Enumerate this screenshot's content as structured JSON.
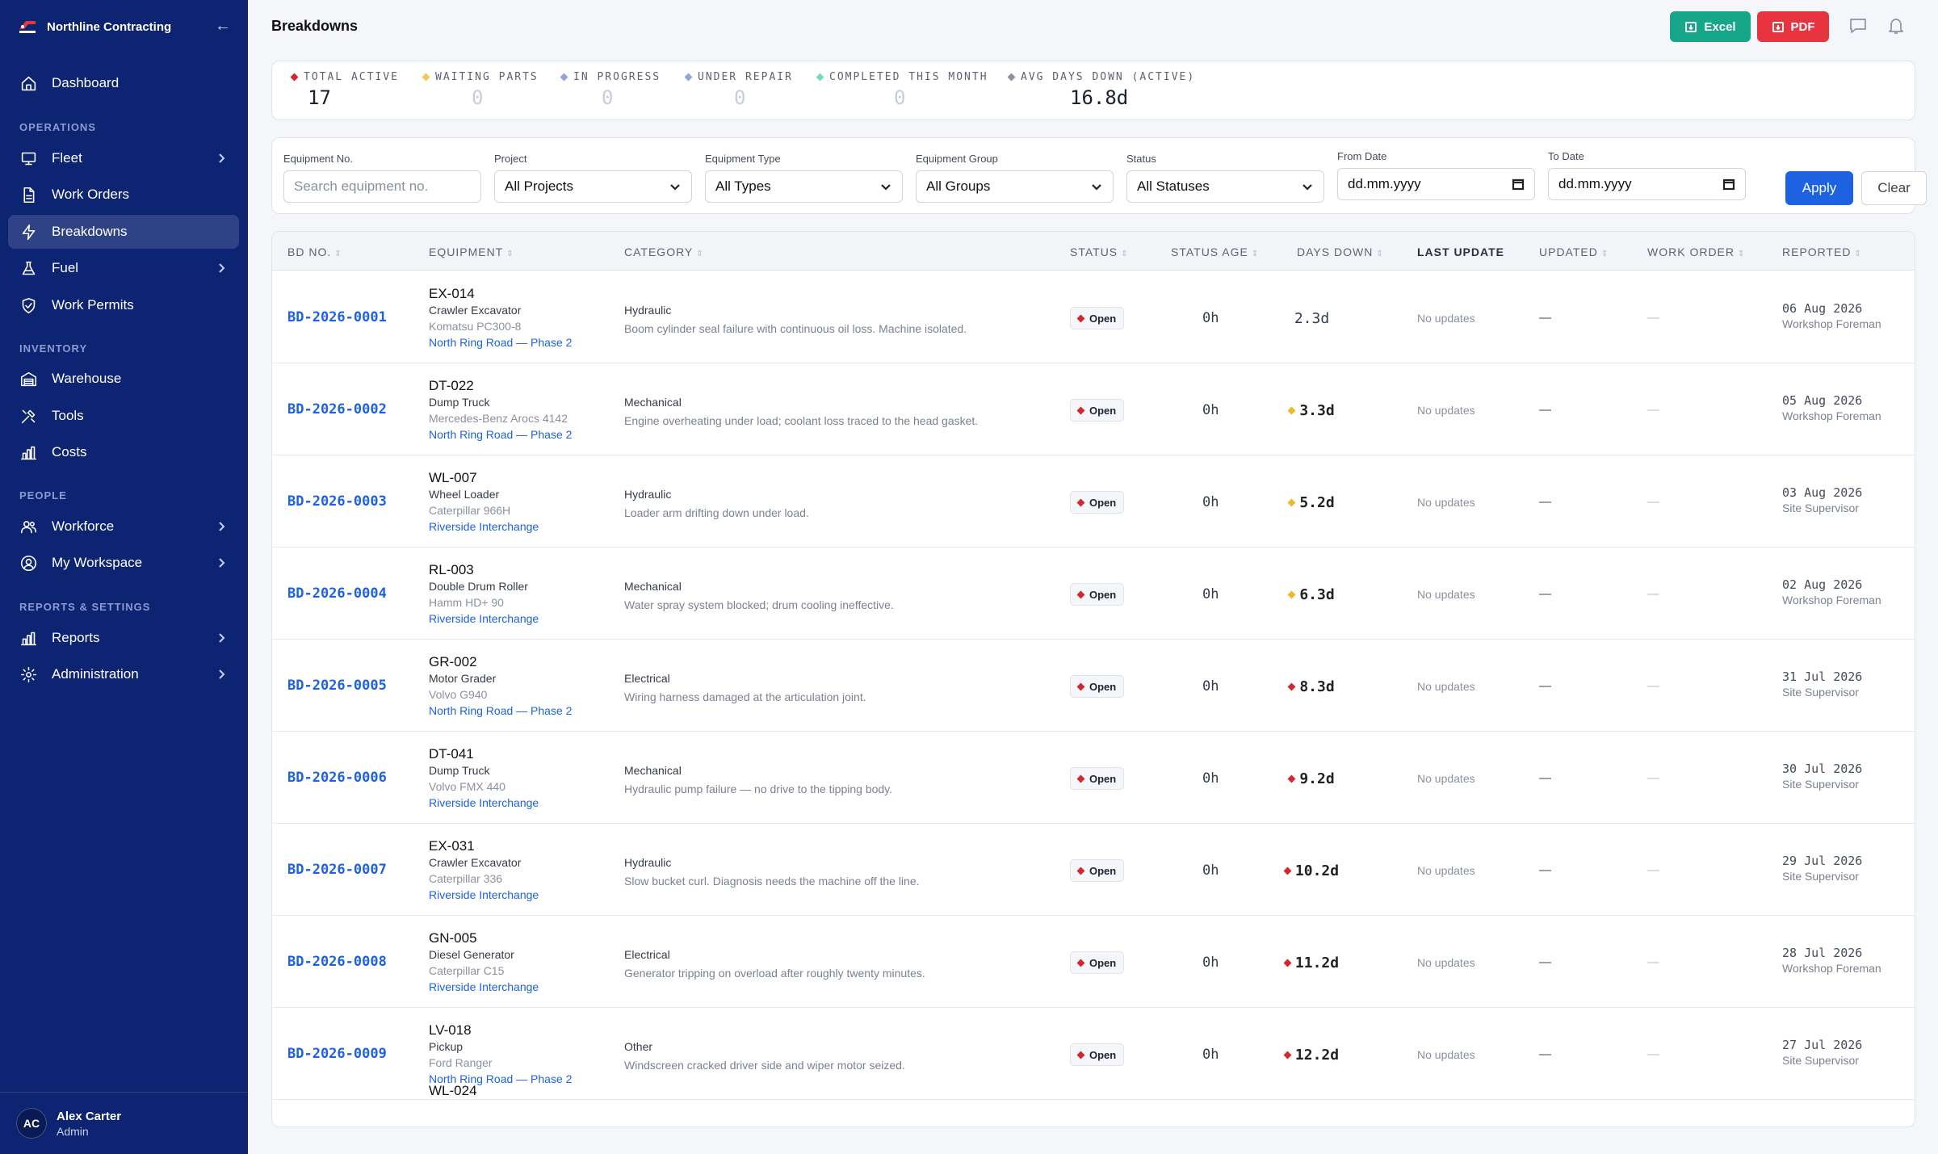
{
  "app": {
    "company": "Northline Contracting"
  },
  "sidebar": {
    "sections": {
      "operations": "OPERATIONS",
      "inventory": "INVENTORY",
      "people": "PEOPLE",
      "reports": "REPORTS & SETTINGS"
    },
    "items": {
      "dashboard": "Dashboard",
      "fleet": "Fleet",
      "work_orders": "Work Orders",
      "breakdowns": "Breakdowns",
      "fuel": "Fuel",
      "work_permits": "Work Permits",
      "warehouse": "Warehouse",
      "tools": "Tools",
      "costs": "Costs",
      "workforce": "Workforce",
      "my_workspace": "My Workspace",
      "reports": "Reports",
      "administration": "Administration"
    },
    "user": {
      "initials": "AC",
      "name": "Alex Carter",
      "role": "Admin"
    }
  },
  "header": {
    "title": "Breakdowns",
    "excel_label": "Excel",
    "pdf_label": "PDF"
  },
  "stats": [
    {
      "label": "TOTAL ACTIVE",
      "value": "17",
      "color": "#d7262f"
    },
    {
      "label": "WAITING PARTS",
      "value": "0",
      "color": "#f2c94c"
    },
    {
      "label": "IN PROGRESS",
      "value": "0",
      "color": "#8ea5e0"
    },
    {
      "label": "UNDER REPAIR",
      "value": "0",
      "color": "#8ea5e0"
    },
    {
      "label": "COMPLETED THIS MONTH",
      "value": "0",
      "color": "#7fd8c0"
    },
    {
      "label": "AVG DAYS DOWN (ACTIVE)",
      "value": "16.8d",
      "color": "#8c93a3"
    }
  ],
  "filters": {
    "equipment_no": {
      "label": "Equipment No.",
      "placeholder": "Search equipment no."
    },
    "project": {
      "label": "Project",
      "value": "All Projects"
    },
    "equipment_type": {
      "label": "Equipment Type",
      "value": "All Types"
    },
    "equipment_group": {
      "label": "Equipment Group",
      "value": "All Groups"
    },
    "status": {
      "label": "Status",
      "value": "All Statuses"
    },
    "from_date": {
      "label": "From Date",
      "value": "dd.mm.yyyy"
    },
    "to_date": {
      "label": "To Date",
      "value": "dd.mm.yyyy"
    },
    "apply_label": "Apply",
    "clear_label": "Clear"
  },
  "table": {
    "columns": {
      "bd_no": "BD NO.",
      "equipment": "EQUIPMENT",
      "category": "CATEGORY",
      "status": "STATUS",
      "status_age": "STATUS AGE",
      "days_down": "DAYS DOWN",
      "last_update": "LAST UPDATE",
      "updated": "UPDATED",
      "work_order": "WORK ORDER",
      "reported": "REPORTED"
    },
    "rows": [
      {
        "bd_no": "BD-2026-0001",
        "eq_code": "EX-014",
        "eq_type": "Crawler Excavator",
        "eq_model": "Komatsu PC300-8",
        "site": "North Ring Road — Phase 2",
        "category": "Hydraulic",
        "description": "Boom cylinder seal failure with continuous oil loss. Machine isolated.",
        "status": "Open",
        "status_age": "0h",
        "days_down": "2.3d",
        "severity": "none",
        "last_update": "No updates",
        "updated": "—",
        "work_order": "—",
        "reported_date": "06 Aug 2026",
        "reported_by": "Workshop Foreman"
      },
      {
        "bd_no": "BD-2026-0002",
        "eq_code": "DT-022",
        "eq_type": "Dump Truck",
        "eq_model": "Mercedes-Benz Arocs 4142",
        "site": "North Ring Road — Phase 2",
        "category": "Mechanical",
        "description": "Engine overheating under load; coolant loss traced to the head gasket.",
        "status": "Open",
        "status_age": "0h",
        "days_down": "3.3d",
        "severity": "warning",
        "last_update": "No updates",
        "updated": "—",
        "work_order": "—",
        "reported_date": "05 Aug 2026",
        "reported_by": "Workshop Foreman"
      },
      {
        "bd_no": "BD-2026-0003",
        "eq_code": "WL-007",
        "eq_type": "Wheel Loader",
        "eq_model": "Caterpillar 966H",
        "site": "Riverside Interchange",
        "category": "Hydraulic",
        "description": "Loader arm drifting down under load.",
        "status": "Open",
        "status_age": "0h",
        "days_down": "5.2d",
        "severity": "warning",
        "last_update": "No updates",
        "updated": "—",
        "work_order": "—",
        "reported_date": "03 Aug 2026",
        "reported_by": "Site Supervisor"
      },
      {
        "bd_no": "BD-2026-0004",
        "eq_code": "RL-003",
        "eq_type": "Double Drum Roller",
        "eq_model": "Hamm HD+ 90",
        "site": "Riverside Interchange",
        "category": "Mechanical",
        "description": "Water spray system blocked; drum cooling ineffective.",
        "status": "Open",
        "status_age": "0h",
        "days_down": "6.3d",
        "severity": "warning",
        "last_update": "No updates",
        "updated": "—",
        "work_order": "—",
        "reported_date": "02 Aug 2026",
        "reported_by": "Workshop Foreman"
      },
      {
        "bd_no": "BD-2026-0005",
        "eq_code": "GR-002",
        "eq_type": "Motor Grader",
        "eq_model": "Volvo G940",
        "site": "North Ring Road — Phase 2",
        "category": "Electrical",
        "description": "Wiring harness damaged at the articulation joint.",
        "status": "Open",
        "status_age": "0h",
        "days_down": "8.3d",
        "severity": "critical",
        "last_update": "No updates",
        "updated": "—",
        "work_order": "—",
        "reported_date": "31 Jul 2026",
        "reported_by": "Site Supervisor"
      },
      {
        "bd_no": "BD-2026-0006",
        "eq_code": "DT-041",
        "eq_type": "Dump Truck",
        "eq_model": "Volvo FMX 440",
        "site": "Riverside Interchange",
        "category": "Mechanical",
        "description": "Hydraulic pump failure — no drive to the tipping body.",
        "status": "Open",
        "status_age": "0h",
        "days_down": "9.2d",
        "severity": "critical",
        "last_update": "No updates",
        "updated": "—",
        "work_order": "—",
        "reported_date": "30 Jul 2026",
        "reported_by": "Site Supervisor"
      },
      {
        "bd_no": "BD-2026-0007",
        "eq_code": "EX-031",
        "eq_type": "Crawler Excavator",
        "eq_model": "Caterpillar 336",
        "site": "Riverside Interchange",
        "category": "Hydraulic",
        "description": "Slow bucket curl. Diagnosis needs the machine off the line.",
        "status": "Open",
        "status_age": "0h",
        "days_down": "10.2d",
        "severity": "critical",
        "last_update": "No updates",
        "updated": "—",
        "work_order": "—",
        "reported_date": "29 Jul 2026",
        "reported_by": "Site Supervisor"
      },
      {
        "bd_no": "BD-2026-0008",
        "eq_code": "GN-005",
        "eq_type": "Diesel Generator",
        "eq_model": "Caterpillar C15",
        "site": "Riverside Interchange",
        "category": "Electrical",
        "description": "Generator tripping on overload after roughly twenty minutes.",
        "status": "Open",
        "status_age": "0h",
        "days_down": "11.2d",
        "severity": "critical",
        "last_update": "No updates",
        "updated": "—",
        "work_order": "—",
        "reported_date": "28 Jul 2026",
        "reported_by": "Workshop Foreman"
      },
      {
        "bd_no": "BD-2026-0009",
        "eq_code": "LV-018",
        "eq_type": "Pickup",
        "eq_model": "Ford Ranger",
        "site": "North Ring Road — Phase 2",
        "category": "Other",
        "description": "Windscreen cracked driver side and wiper motor seized.",
        "status": "Open",
        "status_age": "0h",
        "days_down": "12.2d",
        "severity": "critical",
        "last_update": "No updates",
        "updated": "—",
        "work_order": "—",
        "reported_date": "27 Jul 2026",
        "reported_by": "Site Supervisor"
      }
    ],
    "partial_row_code": "WL-024"
  },
  "colors": {
    "sidebar_bg": "#0d2473",
    "accent": "#1d62e0",
    "excel": "#17a68a",
    "pdf": "#e8343f",
    "critical": "#d7262f",
    "warning": "#f2b824"
  }
}
